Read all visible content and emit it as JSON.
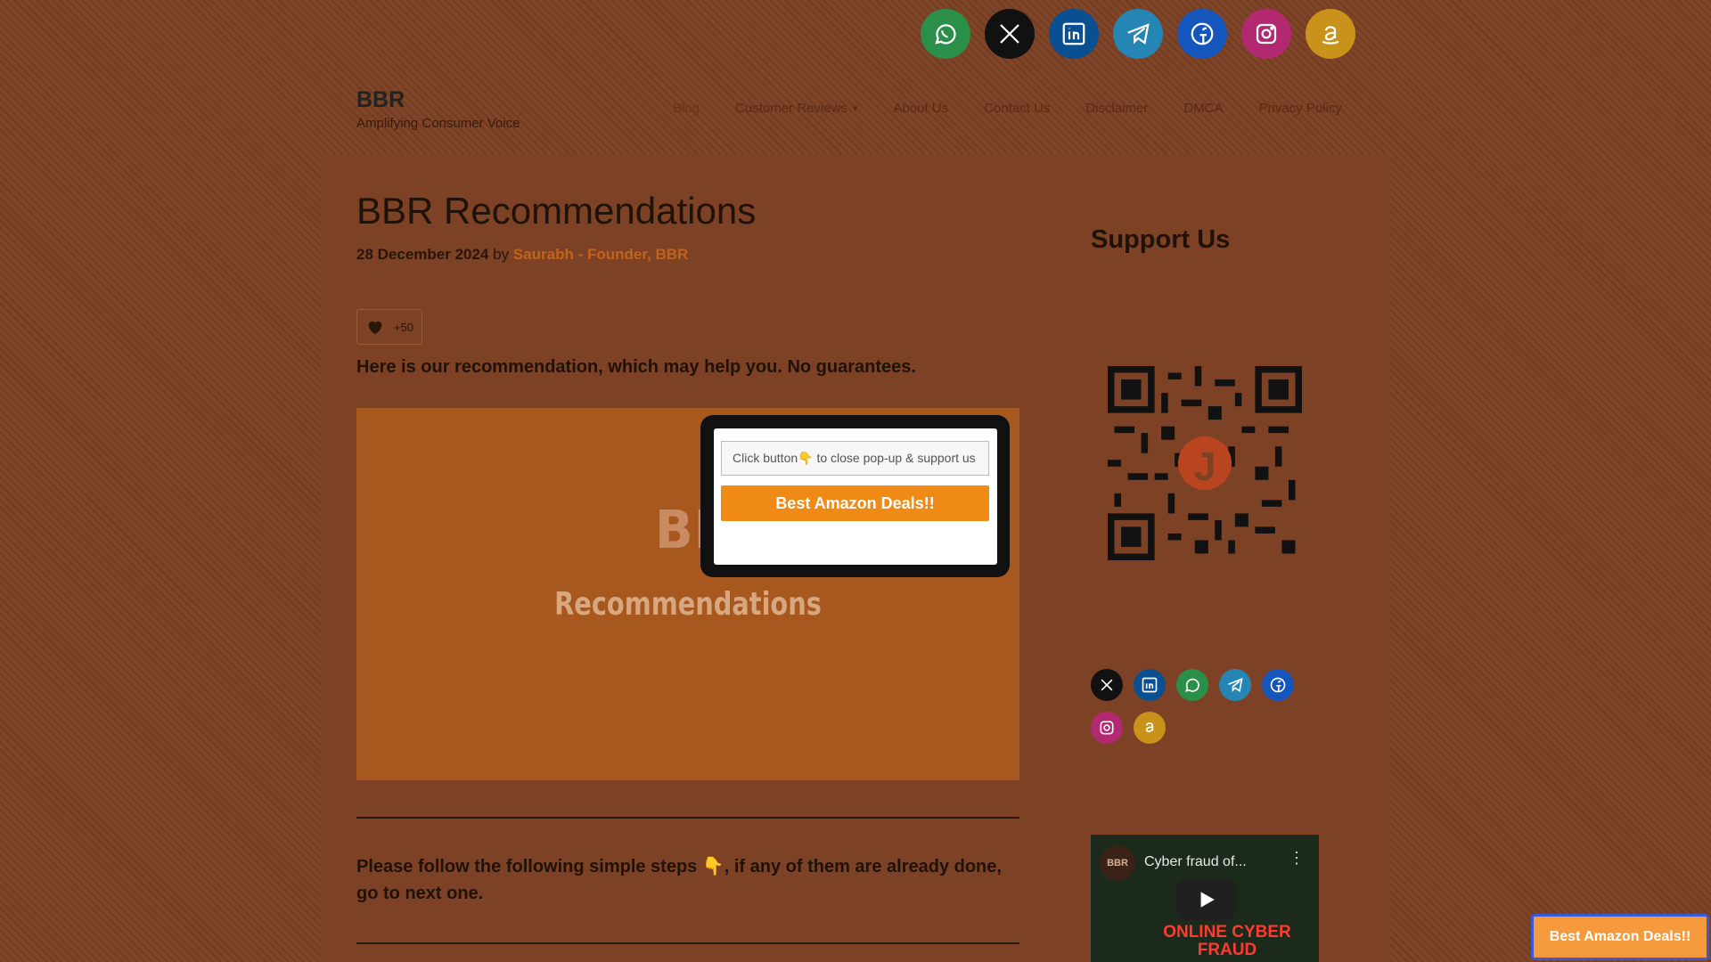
{
  "site": {
    "title": "BBR",
    "tagline": "Amplifying Consumer Voice"
  },
  "nav": {
    "items": [
      {
        "label": "Blog"
      },
      {
        "label": "Customer Reviews"
      },
      {
        "label": "About Us"
      },
      {
        "label": "Contact Us"
      },
      {
        "label": "Disclaimer"
      },
      {
        "label": "DMCA"
      },
      {
        "label": "Privacy Policy"
      }
    ]
  },
  "top_social": [
    "whatsapp-icon",
    "x-icon",
    "linkedin-icon",
    "telegram-icon",
    "facebook-icon",
    "instagram-icon",
    "amazon-icon"
  ],
  "post": {
    "title": "BBR Recommendations",
    "date": "28 December 2024",
    "by": "by",
    "author": "Saurabh - Founder, BBR",
    "likes": "+50",
    "lead": "Here is our recommendation, which may help you. No guarantees.",
    "hero_logo": "BBR",
    "hero_sub": "Recommendations",
    "steps_text": "Please follow the following simple steps 👇, if any of them are already done, go to next one."
  },
  "sidebar": {
    "title": "Support Us",
    "qr_center": "J",
    "social": [
      "x-icon",
      "linkedin-icon",
      "whatsapp-icon",
      "telegram-icon",
      "facebook-icon",
      "instagram-icon",
      "amazon-icon"
    ],
    "video": {
      "title": "Cyber fraud of...",
      "logo": "BBR",
      "overlay": "ONLINE CYBER FRAUD"
    }
  },
  "popup": {
    "input_text": "Click button👇 to close pop-up & support us",
    "button_label": "Best Amazon Deals!!"
  },
  "floating_button": {
    "label": "Best Amazon Deals!!"
  },
  "colors": {
    "whatsapp": "#2a9a4a",
    "x": "#111111",
    "linkedin": "#0a5ca8",
    "telegram": "#2a8fc4",
    "facebook": "#1763d8",
    "instagram": "#c72b78",
    "amazon": "#e3a51c",
    "accent_orange": "#f08a16"
  }
}
